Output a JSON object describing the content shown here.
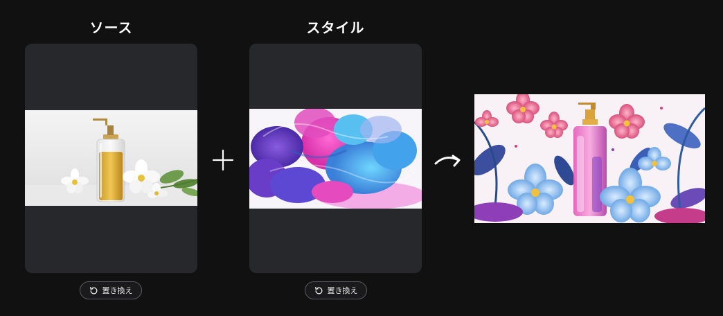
{
  "source": {
    "title": "ソース",
    "replace_label": "置き換え"
  },
  "style": {
    "title": "スタイル",
    "replace_label": "置き換え"
  },
  "icons": {
    "replace": "rotate-ccw-icon",
    "plus": "plus-icon",
    "arrow": "curved-arrow-right-icon"
  },
  "colors": {
    "background": "#111112",
    "card": "#27282c",
    "button_border": "#5a5b60"
  }
}
